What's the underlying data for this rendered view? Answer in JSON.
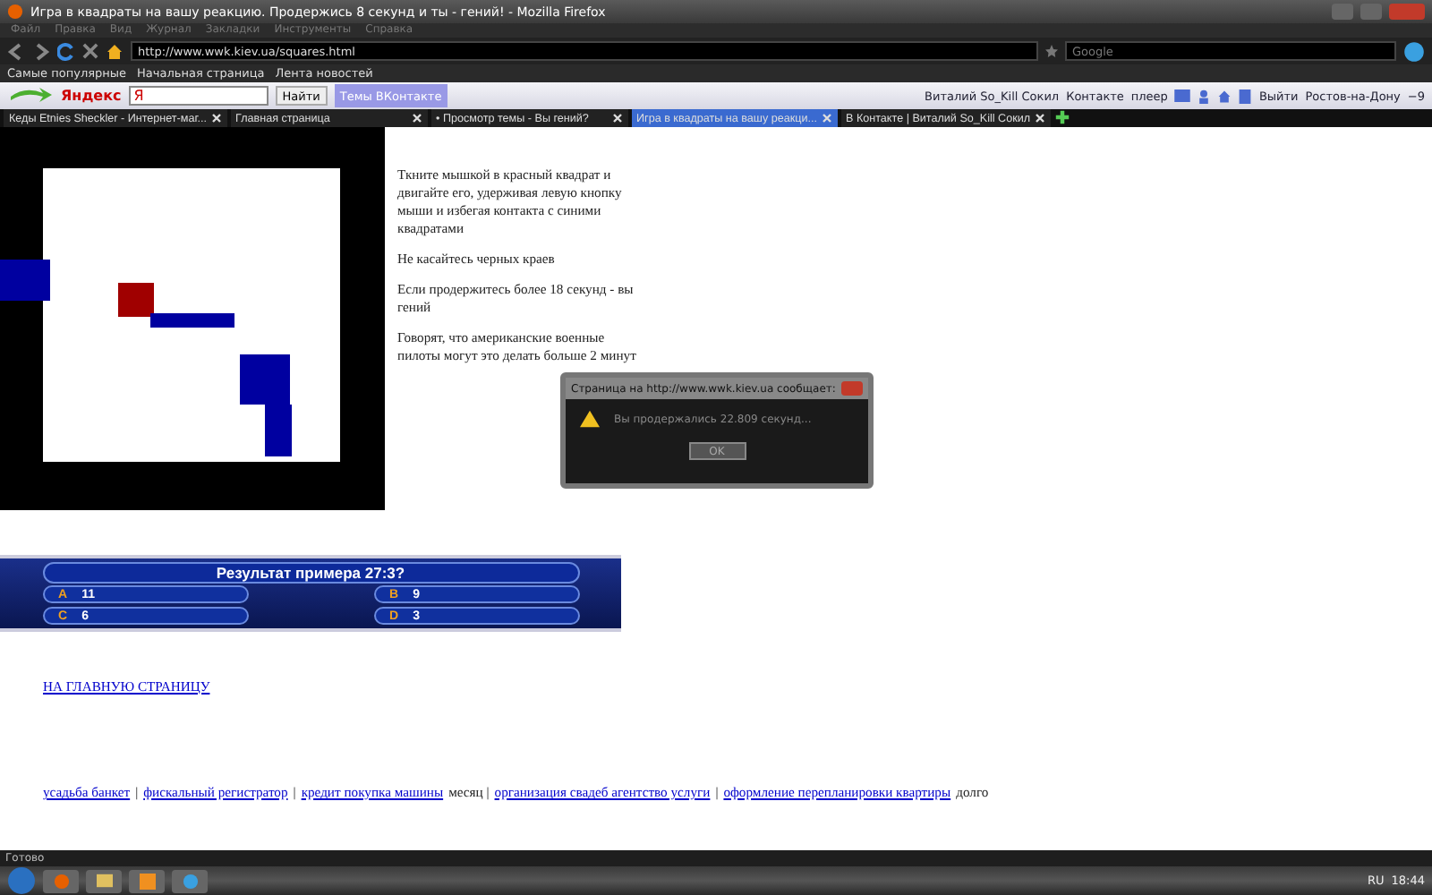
{
  "window": {
    "title": "Игра в квадраты на вашу реакцию. Продержись 8 секунд и ты - гений! - Mozilla Firefox"
  },
  "menu": [
    "Файл",
    "Правка",
    "Вид",
    "Журнал",
    "Закладки",
    "Инструменты",
    "Справка"
  ],
  "nav": {
    "url": "http://www.wwk.kiev.ua/squares.html",
    "search_placeholder": "Google"
  },
  "bookmarks": [
    "Самые популярные",
    "Начальная страница",
    "Лента новостей"
  ],
  "yandex_bar": {
    "logo": "Яндекс",
    "search_value": "Я",
    "search_button": "Найти",
    "vk_topics": "Темы ВКонтакте",
    "user": "Виталий So_Kill Сокил",
    "vk": "Контакте",
    "player": "плеер",
    "logout": "Выйти",
    "city": "Ростов-на-Дону",
    "temperature": "−9"
  },
  "tabs": [
    {
      "label": "Кеды Etnies Sheckler - Интернет-маг...",
      "selected": false
    },
    {
      "label": "Главная страница",
      "selected": false
    },
    {
      "label": "• Просмотр темы - Вы гений?",
      "selected": false
    },
    {
      "label": "Игра в квадраты на вашу реакци...",
      "selected": true
    },
    {
      "label": "В Контакте | Виталий So_Kill Сокил",
      "selected": false
    }
  ],
  "instructions": [
    "Ткните мышкой в красный квадрат и двигайте его, удерживая левую кнопку мыши и избегая контакта с синими квадратами",
    "Не касайтесь черных краев",
    "Если продержитесь более 18 секунд - вы гений",
    "Говорят, что американские военные пилоты могут это делать больше 2 минут"
  ],
  "quiz": {
    "question": "Результат примера 27:3?",
    "answers": [
      {
        "letter": "A",
        "text": "11"
      },
      {
        "letter": "B",
        "text": "9"
      },
      {
        "letter": "C",
        "text": "6"
      },
      {
        "letter": "D",
        "text": "3"
      }
    ]
  },
  "home_link": "НА ГЛАВНУЮ СТРАНИЦУ",
  "footer": [
    {
      "kind": "link",
      "text": "усадьба банкет"
    },
    {
      "kind": "text",
      "text": "|"
    },
    {
      "kind": "link",
      "text": "фискальный регистратор"
    },
    {
      "kind": "text",
      "text": "|"
    },
    {
      "kind": "link",
      "text": "кредит покупка машины"
    },
    {
      "kind": "text",
      "text": "месяц |"
    },
    {
      "kind": "link",
      "text": "организация свадеб агентство услуги"
    },
    {
      "kind": "text",
      "text": "|"
    },
    {
      "kind": "link",
      "text": "оформление перепланировки квартиры"
    },
    {
      "kind": "text",
      "text": "долго"
    }
  ],
  "dialog": {
    "title": "Страница на http://www.wwk.kiev.ua сообщает:",
    "message": "Вы продержались 22.809 секунд...",
    "button": "OK"
  },
  "status_bar": "Готово",
  "taskbar": {
    "language": "RU",
    "clock": "18:44"
  }
}
